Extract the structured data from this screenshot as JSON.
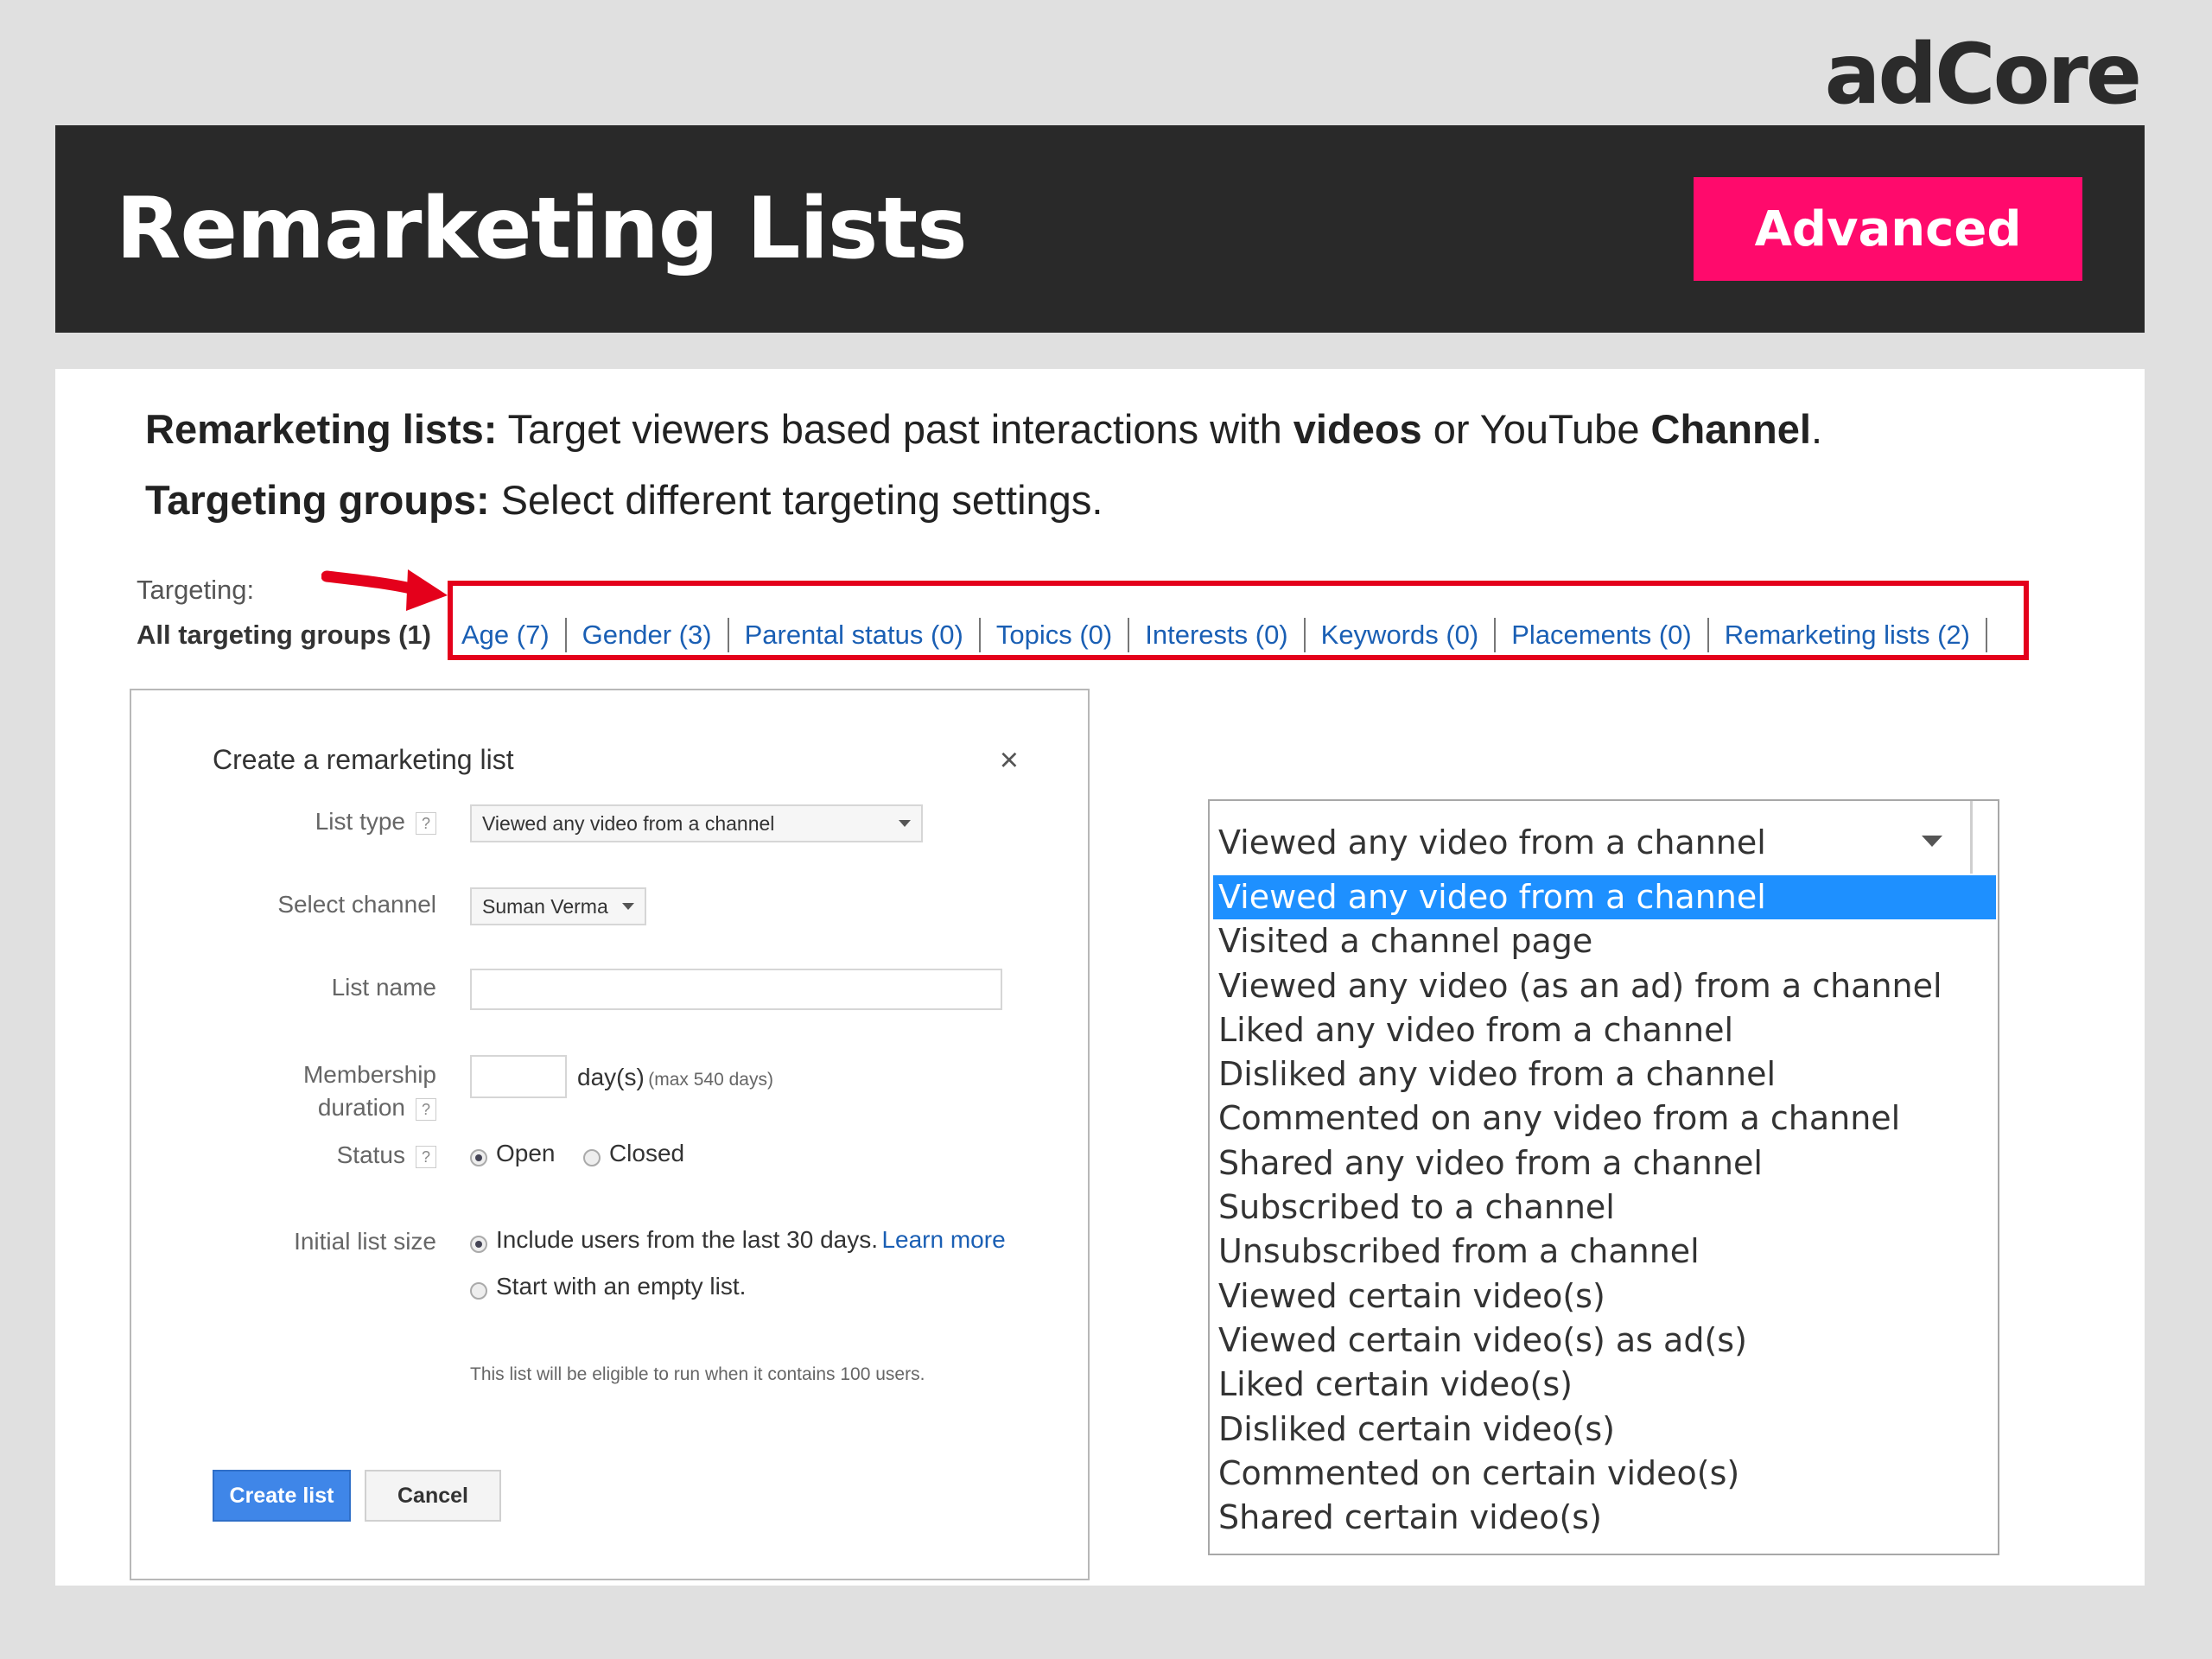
{
  "brand": {
    "logo": "adCore"
  },
  "header": {
    "title": "Remarketing Lists",
    "badge": "Advanced",
    "badge_color": "#ff0a6c"
  },
  "intro": {
    "line1": {
      "term": "Remarketing lists:",
      "text_a": " Target viewers based past interactions with ",
      "bold_a": "videos",
      "text_b": " or YouTube ",
      "bold_b": "Channel",
      "text_c": "."
    },
    "line2": {
      "term": "Targeting groups:",
      "text": " Select different targeting settings."
    }
  },
  "targeting": {
    "label": "Targeting:",
    "all_groups": "All targeting groups (1)",
    "tabs": [
      "Age (7)",
      "Gender (3)",
      "Parental status (0)",
      "Topics (0)",
      "Interests (0)",
      "Keywords (0)",
      "Placements (0)",
      "Remarketing lists (2)"
    ]
  },
  "dialog": {
    "title": "Create a remarketing list",
    "close": "×",
    "list_type": {
      "label": "List type",
      "help": "?",
      "value": "Viewed any video from a channel"
    },
    "select_channel": {
      "label": "Select channel",
      "value": "Suman Verma"
    },
    "list_name": {
      "label": "List name",
      "value": ""
    },
    "membership": {
      "label_line1": "Membership",
      "label_line2": "duration",
      "help": "?",
      "value": "",
      "unit": "day(s)",
      "note": "(max 540 days)"
    },
    "status": {
      "label": "Status",
      "help": "?",
      "options": [
        "Open",
        "Closed"
      ]
    },
    "initial_size": {
      "label": "Initial list size",
      "option1": "Include users from the last 30 days.",
      "learn_more": "Learn more",
      "option2": "Start with an empty list."
    },
    "eligibility_note": "This list will be eligible to run when it contains 100 users.",
    "create_button": "Create list",
    "cancel_button": "Cancel"
  },
  "dropdown": {
    "selected": "Viewed any video from a channel",
    "options": [
      "Viewed any video from a channel",
      "Visited a channel page",
      "Viewed any video (as an ad) from a channel",
      "Liked any video from a channel",
      "Disliked any video from a channel",
      "Commented on any video from a channel",
      "Shared any video from a channel",
      "Subscribed to a channel",
      "Unsubscribed from a channel",
      "Viewed certain video(s)",
      "Viewed certain video(s) as ad(s)",
      "Liked certain video(s)",
      "Disliked certain video(s)",
      "Commented on certain video(s)",
      "Shared certain video(s)"
    ],
    "highlight_color": "#1e90ff"
  }
}
